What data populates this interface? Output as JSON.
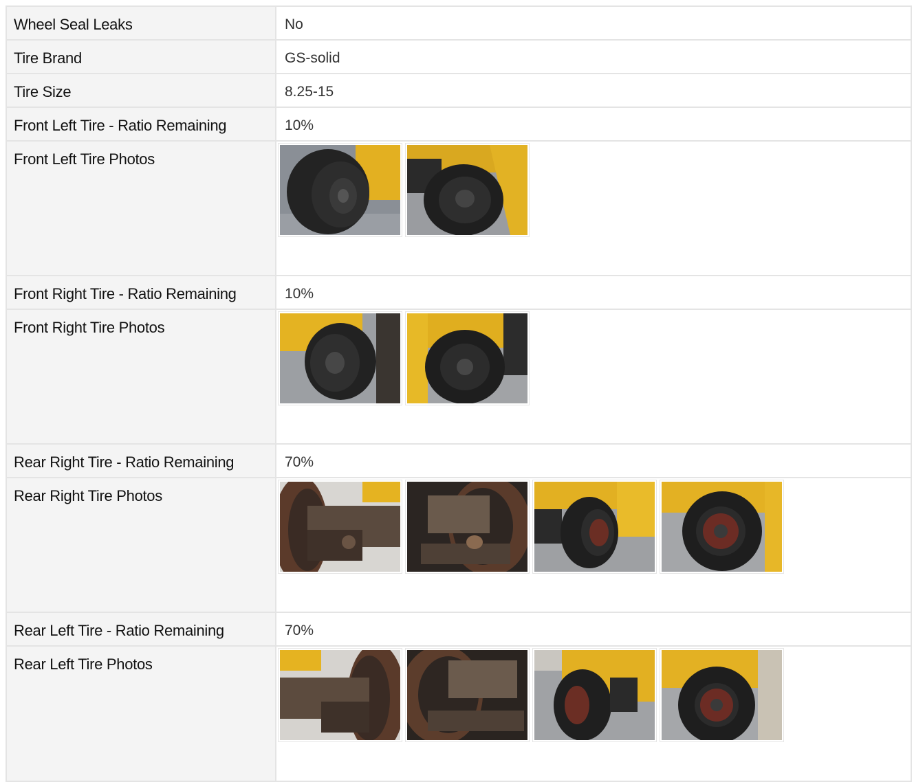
{
  "rows": [
    {
      "label": "Wheel Seal Leaks",
      "value": "No"
    },
    {
      "label": "Tire Brand",
      "value": "GS-solid"
    },
    {
      "label": "Tire Size",
      "value": "8.25-15"
    },
    {
      "label": "Front Left Tire - Ratio Remaining",
      "value": "10%"
    },
    {
      "label": "Front Left Tire Photos",
      "photos": [
        "front-left-tire-photo-1",
        "front-left-tire-photo-2"
      ]
    },
    {
      "label": "Front Right Tire - Ratio Remaining",
      "value": "10%"
    },
    {
      "label": "Front Right Tire Photos",
      "photos": [
        "front-right-tire-photo-1",
        "front-right-tire-photo-2"
      ]
    },
    {
      "label": "Rear Right Tire - Ratio Remaining",
      "value": "70%"
    },
    {
      "label": "Rear Right Tire Photos",
      "photos": [
        "rear-right-tire-photo-1",
        "rear-right-tire-photo-2",
        "rear-right-tire-photo-3",
        "rear-right-tire-photo-4"
      ]
    },
    {
      "label": "Rear Left Tire - Ratio Remaining",
      "value": "70%"
    },
    {
      "label": "Rear Left Tire Photos",
      "photos": [
        "rear-left-tire-photo-1",
        "rear-left-tire-photo-2",
        "rear-left-tire-photo-3",
        "rear-left-tire-photo-4"
      ]
    }
  ],
  "colors": {
    "forklift_yellow": "#e8b51e",
    "tire_black": "#1e1e1e",
    "pavement_gray": "#8b8f96",
    "label_background": "#f4f4f4",
    "cell_border": "#e4e4e4"
  }
}
